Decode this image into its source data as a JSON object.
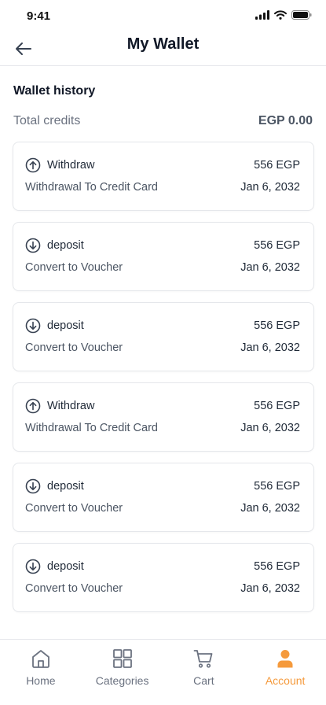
{
  "status_bar": {
    "time": "9:41"
  },
  "header": {
    "title": "My Wallet"
  },
  "wallet": {
    "section_title": "Wallet history",
    "total_label": "Total credits",
    "total_value": "EGP 0.00"
  },
  "transactions": [
    {
      "type": "Withdraw",
      "icon": "arrow-up-circle-icon",
      "amount": "556 EGP",
      "description": "Withdrawal To Credit Card",
      "date": "Jan 6, 2032"
    },
    {
      "type": "deposit",
      "icon": "arrow-down-circle-icon",
      "amount": "556 EGP",
      "description": "Convert to Voucher",
      "date": "Jan 6, 2032"
    },
    {
      "type": "deposit",
      "icon": "arrow-down-circle-icon",
      "amount": "556 EGP",
      "description": "Convert to Voucher",
      "date": "Jan 6, 2032"
    },
    {
      "type": "Withdraw",
      "icon": "arrow-up-circle-icon",
      "amount": "556 EGP",
      "description": "Withdrawal To Credit Card",
      "date": "Jan 6, 2032"
    },
    {
      "type": "deposit",
      "icon": "arrow-down-circle-icon",
      "amount": "556 EGP",
      "description": "Convert to Voucher",
      "date": "Jan 6, 2032"
    },
    {
      "type": "deposit",
      "icon": "arrow-down-circle-icon",
      "amount": "556 EGP",
      "description": "Convert to Voucher",
      "date": "Jan 6, 2032"
    }
  ],
  "nav": {
    "items": [
      {
        "label": "Home",
        "icon": "home-icon"
      },
      {
        "label": "Categories",
        "icon": "grid-icon"
      },
      {
        "label": "Cart",
        "icon": "cart-icon"
      },
      {
        "label": "Account",
        "icon": "user-icon",
        "active": true
      }
    ]
  },
  "colors": {
    "accent": "#f59a3c",
    "text": "#1f2937",
    "muted": "#6b7280",
    "border": "#e5e7eb"
  }
}
